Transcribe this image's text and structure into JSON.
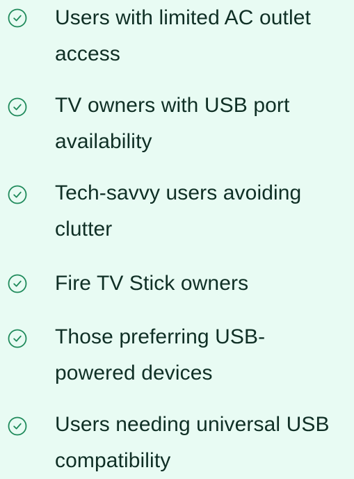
{
  "colors": {
    "background": "#e8fbf3",
    "text": "#0f2f25",
    "check": "#1f8a5b"
  },
  "items": [
    {
      "icon": "check-circle-icon",
      "line1": "Users with limited AC outlet",
      "line2": "access"
    },
    {
      "icon": "check-circle-icon",
      "line1": "TV owners with USB port",
      "line2": "availability"
    },
    {
      "icon": "check-circle-icon",
      "line1": "Tech-savvy users avoiding",
      "line2": "clutter"
    },
    {
      "icon": "check-circle-icon",
      "line1": "Fire TV Stick owners",
      "line2": ""
    },
    {
      "icon": "check-circle-icon",
      "line1": "Those preferring USB-",
      "line2": "powered devices"
    },
    {
      "icon": "check-circle-icon",
      "line1": "Users needing universal USB",
      "line2": "compatibility"
    }
  ]
}
